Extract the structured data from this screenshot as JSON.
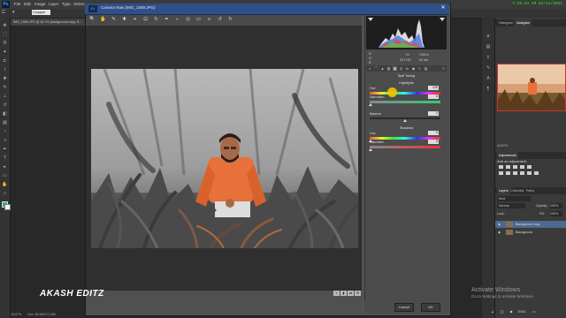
{
  "ps": {
    "logo": "Ps",
    "menu": [
      "File",
      "Edit",
      "Image",
      "Layer",
      "Type",
      "Select"
    ],
    "clock": "7:25:34 AM 01/12/2021",
    "options_select": "Cropper",
    "doc_tab": "IMG_1589.JPG @ 16.7% (background copy, R...",
    "status_zoom": "16.67%",
    "status_doc": "Doc: 86.5M/172.8M",
    "navigator_zoom": "16.67%"
  },
  "panels": {
    "tabs_top": [
      "Histogram",
      "Navigator"
    ],
    "adjustments_tab": "Adjustments",
    "adjustments_title": "Add an adjustment",
    "layers_tabs": [
      "Layers",
      "Channels",
      "Paths"
    ],
    "kind": "Kind",
    "blend_mode": "Normal",
    "opacity_label": "Opacity:",
    "opacity_value": "100%",
    "lock_label": "Lock:",
    "fill_label": "Fill:",
    "fill_value": "100%",
    "layers": [
      {
        "name": "Background copy",
        "selected": true
      },
      {
        "name": "Background",
        "selected": false
      }
    ]
  },
  "camera_raw": {
    "title": "Camera Raw (IMG_1589.JPG)",
    "close_glyph": "✕",
    "tools": [
      "🔍",
      "✋",
      "✎",
      "✚",
      "⌖",
      "⊡",
      "↻",
      "✒",
      "⌐",
      "◎",
      "▭",
      "≡",
      "↺",
      "↻"
    ],
    "readout": {
      "r": "R:",
      "g": "G:",
      "b": "B:",
      "exposure": "f/3",
      "shutter": "1/500 s",
      "iso": "ISO 100",
      "focal": "50 mm"
    },
    "panel_title": "Split Toning",
    "highlights_title": "Highlights",
    "highlights": {
      "hue_label": "Hue",
      "hue_value": "120",
      "saturation_label": "Saturation",
      "saturation_value": "0"
    },
    "balance_label": "Balance",
    "balance_value": "0",
    "shadows_title": "Shadows",
    "shadows": {
      "hue_label": "Hue",
      "hue_value": "0",
      "saturation_label": "Saturation",
      "saturation_value": "0"
    },
    "cancel_label": "Cancel",
    "ok_label": "OK"
  },
  "watermark": "AKASH EDITZ",
  "activate": {
    "line1": "Activate Windows",
    "line2": "Go to Settings to activate Windows."
  },
  "taskbar_lang": "ENG",
  "colors": {
    "dialog_title": "#2f4f89",
    "accent_orange": "#e8703a",
    "clock_green": "#1aff1a",
    "hue_highlight": "#f2c400"
  }
}
